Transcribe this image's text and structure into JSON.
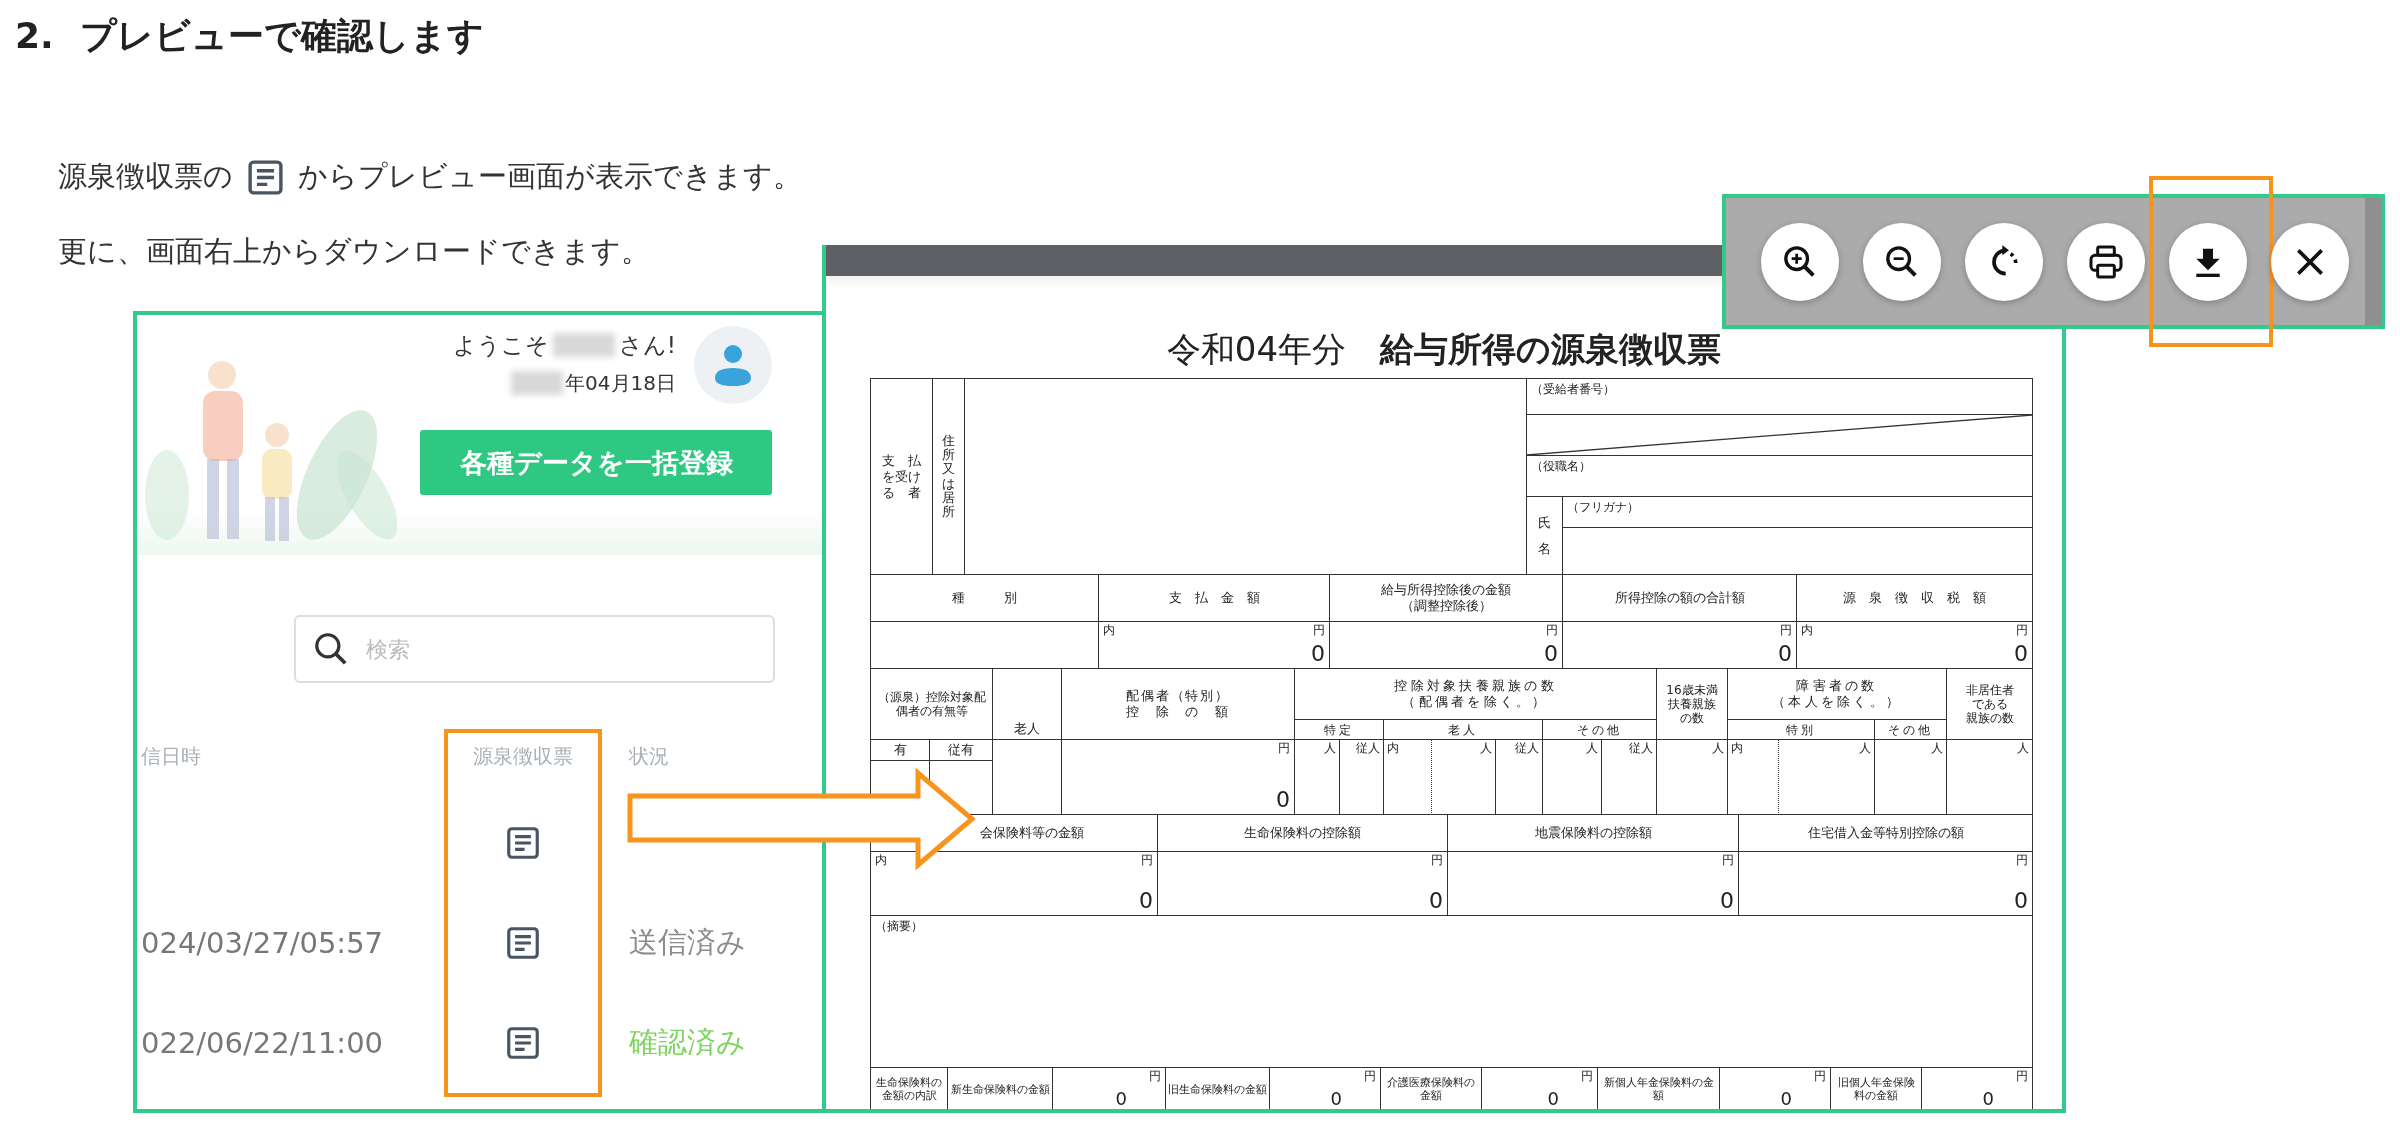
{
  "heading": {
    "number": "2.",
    "title": "プレビューで確認します"
  },
  "intro": {
    "before_icon": "源泉徴収票の",
    "after_icon": "からプレビュー画面が表示できます。"
  },
  "note": "更に、画面右上からダウンロードできます。",
  "app": {
    "greeting": {
      "prefix": "ようこそ",
      "suffix": "さん!",
      "date": "年04月18日"
    },
    "bulk_button": "各種データを一括登録",
    "search": {
      "placeholder": "検索"
    },
    "table": {
      "columns": [
        {
          "label": "信日時",
          "highlighted": false
        },
        {
          "label": "源泉徴収票",
          "highlighted": true
        },
        {
          "label": "状況",
          "highlighted": false
        }
      ],
      "rows": [
        {
          "preview": true
        },
        {
          "preview": true,
          "sent_at": "024/03/27/05:57",
          "status": "送信済み",
          "color": "#8c8c8c"
        },
        {
          "preview": true,
          "sent_at": "022/06/22/11:00",
          "status": "確認済み",
          "color": "#7fd35f"
        }
      ]
    }
  },
  "preview": {
    "toolbar": {
      "buttons": [
        {
          "kind": "zoom_in",
          "highlighted": false
        },
        {
          "kind": "zoom_out",
          "highlighted": false
        },
        {
          "kind": "rotate",
          "highlighted": false
        },
        {
          "kind": "print",
          "highlighted": false
        },
        {
          "kind": "download",
          "highlighted": true
        },
        {
          "kind": "close",
          "highlighted": false
        }
      ]
    },
    "form": {
      "title": "令和04年分　**給与所得の源泉徴収票**",
      "payee": {
        "label": [
          "支　払",
          "を受け",
          "る　者"
        ],
        "address_label": "住所又は居所",
        "recipient_no_label": "（受給者番号）",
        "position_label": "（役職名）",
        "name_label": "氏名",
        "furigana_label": "（フリガナ）"
      },
      "amounts": {
        "headers": [
          [
            "種　　　別"
          ],
          [
            "支　払　金　額"
          ],
          [
            "給与所得控除後の金額",
            "（調整控除後）"
          ],
          [
            "所得控除の額の合計額"
          ],
          [
            "源　泉　徴　収　税　額"
          ]
        ],
        "values": [
          {
            "inner": "内",
            "unit": "円",
            "value": "0"
          },
          {
            "unit": "円",
            "value": "0"
          },
          {
            "unit": "円",
            "value": "0"
          },
          {
            "inner": "内",
            "unit": "円",
            "value": "0"
          }
        ]
      },
      "dependents": {
        "spouse_label": "（源泉）控除対象配偶者の有無等",
        "spouse_elderly": "老人",
        "has": "有",
        "has_other": "従有",
        "spouse_deduction_label": [
          "配偶者（特別）",
          "控　除　の　額"
        ],
        "spouse_deduction_unit": "円",
        "spouse_deduction_value": "0",
        "dependents_label": [
          "控除対象扶養親族の数",
          "（配偶者を除く。）"
        ],
        "dependents_sub": [
          "特定",
          "老人",
          "その他"
        ],
        "dependents_units": [
          "人",
          "従人",
          "内",
          "人",
          "従人",
          "人",
          "従人"
        ],
        "under16_label": [
          "16歳未満",
          "扶養親族",
          "の数"
        ],
        "under16_unit": "人",
        "disabled_label": [
          "障害者の数",
          "（本人を除く。）"
        ],
        "disabled_sub": [
          "特別",
          "その他"
        ],
        "disabled_units": [
          "内",
          "人",
          "人"
        ],
        "nonresident_label": [
          "非居住者",
          "である",
          "親族の数"
        ],
        "nonresident_unit": "人"
      },
      "insurance": {
        "headers": [
          "会保険料等の金額",
          "生命保険料の控除額",
          "地震保険料の控除額",
          "住宅借入金等特別控除の額"
        ],
        "values": [
          {
            "inner": "内",
            "unit": "円",
            "value": "0"
          },
          {
            "unit": "円",
            "value": "0"
          },
          {
            "unit": "円",
            "value": "0"
          },
          {
            "unit": "円",
            "value": "0"
          }
        ]
      },
      "summary_label": "（摘要）",
      "breakdown": {
        "label": "生命保険料の金額の内訳",
        "items": [
          {
            "label": "新生命保険料の金額",
            "unit": "円",
            "value": "0"
          },
          {
            "label": "旧生命保険料の金額",
            "unit": "円",
            "value": "0"
          },
          {
            "label": "介護医療保険料の金額",
            "unit": "円",
            "value": "0"
          },
          {
            "label": "新個人年金保険料の金額",
            "unit": "円",
            "value": "0"
          },
          {
            "label": "旧個人年金保険料の金額",
            "unit": "円",
            "value": "0"
          }
        ]
      }
    }
  }
}
